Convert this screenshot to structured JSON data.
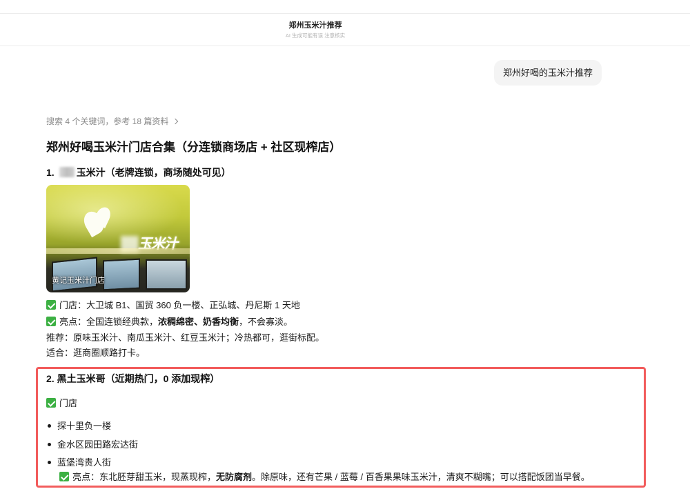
{
  "window": {
    "title": "郑州玉米汁推荐",
    "subtitle": "AI 生成可能有误 注意核实"
  },
  "user_message": "郑州好喝的玉米汁推荐",
  "search_summary": "搜索 4 个关键词，参考 18 篇资料",
  "answer": {
    "title": "郑州好喝玉米汁门店合集（分连锁商场店 + 社区现榨店）",
    "section1": {
      "number": "1.",
      "name_suffix": "玉米汁（老牌连锁，商场随处可见）",
      "image": {
        "sign_text": "玉米汁",
        "caption": "黄记玉米汁门店"
      },
      "stores": "门店：大卫城 B1、国贸 360 负一楼、正弘城、丹尼斯 1 天地",
      "highlight": [
        "亮点：全国连锁经典款，",
        "浓稠绵密、奶香均衡",
        "，不会寡淡。"
      ],
      "recommend": "推荐：原味玉米汁、南瓜玉米汁、红豆玉米汁；冷热都可，逛街标配。",
      "suitable": "适合：逛商圈顺路打卡。"
    },
    "section2": {
      "heading": "2. 黑土玉米哥（近期热门，0 添加现榨）",
      "stores_label": "门店",
      "stores": [
        "探十里负一楼",
        "金水区园田路宏达街",
        "蓝堡湾贵人街"
      ],
      "highlight": [
        "亮点：东北胚芽甜玉米，现蒸现榨，",
        "无防腐剂",
        "。除原味，还有芒果 / 蓝莓 / 百香果果味玉米汁，清爽不糊嘴；可以搭配饭团当早餐。"
      ]
    }
  },
  "colors": {
    "accent": "#3cb043",
    "frame": "#f25c5c",
    "bubble": "#f4f4f4"
  },
  "icons": {
    "check": "check-icon",
    "chevron": "chevron-right-icon",
    "bullet": "bullet-icon"
  }
}
